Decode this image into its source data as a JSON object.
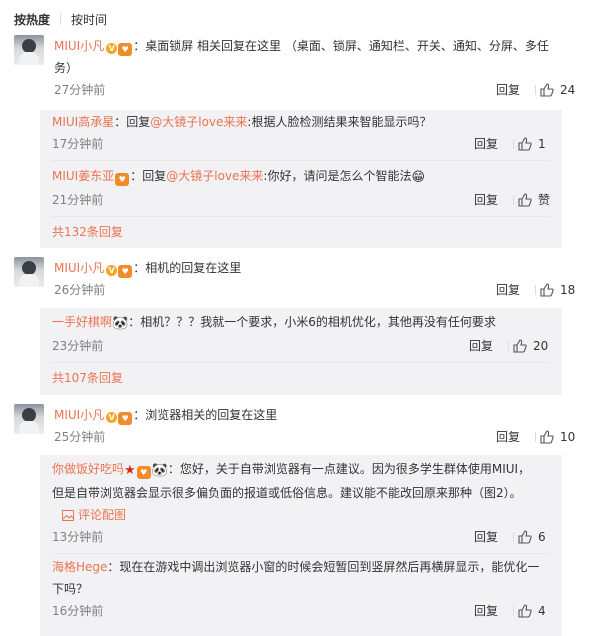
{
  "sort": {
    "hot": "按热度",
    "time": "按时间"
  },
  "comments": [
    {
      "user": "MIUI小凡",
      "text": "：桌面锁屏 相关回复在这里 （桌面、锁屏、通知栏、开关、通知、分屏、多任",
      "text2": "务）",
      "time": "27分钟前",
      "reply": "回复",
      "likes": "24",
      "replies": [
        {
          "user": "MIUI高承星",
          "pre": "：回复",
          "mention": "@大镜子love来来",
          "text": ":根据人脸检测结果来智能显示吗？",
          "time": "17分钟前",
          "reply": "回复",
          "likes": "1"
        },
        {
          "user": "MIUI姜东亚",
          "pre": "：回复",
          "mention": "@大镜子love来来",
          "text": ":你好，请问是怎么个智能法",
          "time": "21分钟前",
          "reply": "回复",
          "likes": "赞"
        }
      ],
      "more": "共132条回复"
    },
    {
      "user": "MIUI小凡",
      "text": "：相机的回复在这里",
      "time": "26分钟前",
      "reply": "回复",
      "likes": "18",
      "replies": [
        {
          "user": "一手好棋啊",
          "text": "：相机？？？我就一个要求，小米6的相机优化，其他再没有任何要求",
          "time": "23分钟前",
          "reply": "回复",
          "likes": "20"
        }
      ],
      "more": "共107条回复"
    },
    {
      "user": "MIUI小凡",
      "text": "：浏览器相关的回复在这里",
      "time": "25分钟前",
      "reply": "回复",
      "likes": "10",
      "replies": [
        {
          "user": "你做饭好吃吗",
          "text": "：您好，关于自带浏览器有一点建议。因为很多学生群体使用MIUI，",
          "text2": "但是自带浏览器会显示很多偏负面的报道或低俗信息。建议能不能改回原来那种（图2）。",
          "pic": "评论配图",
          "time": "13分钟前",
          "reply": "回复",
          "likes": "6"
        },
        {
          "user": "海格Hege",
          "text": "：现在在游戏中调出浏览器小窗的时候会短暂回到竖屏然后再横屏显示，能优化一",
          "text2": "下吗？",
          "time": "16分钟前",
          "reply": "回复",
          "likes": "4"
        }
      ]
    }
  ]
}
